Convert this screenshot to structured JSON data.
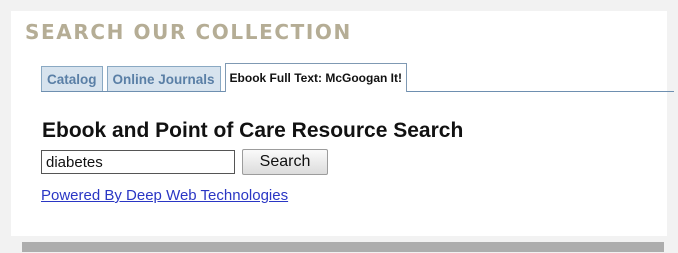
{
  "section_heading": "SEARCH OUR COLLECTION",
  "tabs": [
    {
      "label": "Catalog",
      "active": false
    },
    {
      "label": "Online Journals",
      "active": false
    },
    {
      "label": "Ebook Full Text: McGoogan It!",
      "active": true
    }
  ],
  "search": {
    "title": "Ebook and Point of Care Resource Search",
    "query": "diabetes",
    "button_label": "Search"
  },
  "footer_link": "Powered By Deep Web Technologies",
  "colors": {
    "heading": "#b5ad95",
    "tab_inactive_bg": "#d7e3ee",
    "tab_inactive_text": "#5a7fa6",
    "tab_border": "#8aa9c3",
    "link": "#2a36c4",
    "page_bg": "#f2f2f2",
    "bottom_bar": "#adadad"
  }
}
